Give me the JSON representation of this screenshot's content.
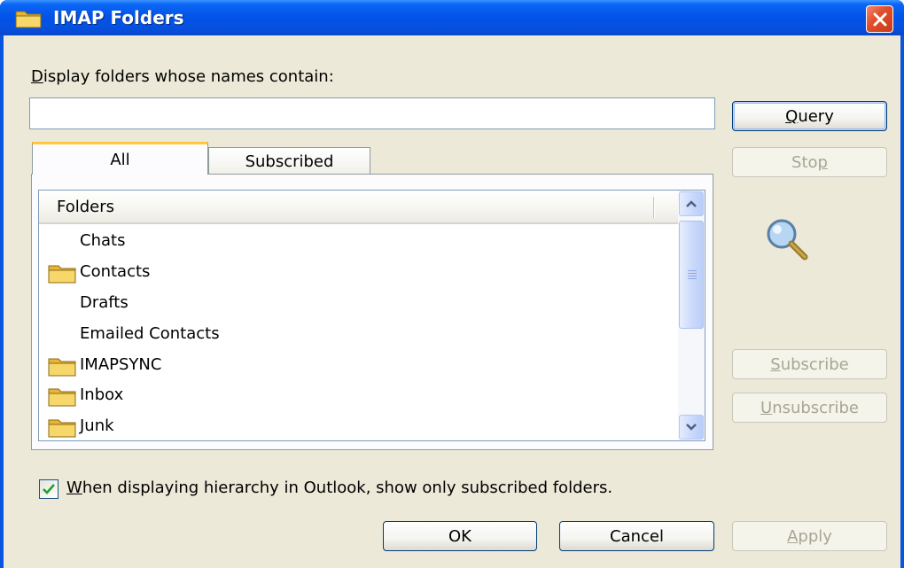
{
  "window": {
    "title": "IMAP Folders",
    "title_icon": "folder-icon",
    "close_icon": "close-icon"
  },
  "filter": {
    "label_pre": "",
    "label_ul": "D",
    "label_post": "isplay folders whose names contain:",
    "value": "",
    "placeholder": ""
  },
  "buttons": {
    "query": {
      "pre": "",
      "ul": "Q",
      "post": "uery"
    },
    "stop": {
      "pre": "Sto",
      "ul": "p",
      "post": ""
    },
    "subscribe": {
      "pre": "",
      "ul": "S",
      "post": "ubscribe"
    },
    "unsubscribe": {
      "pre": "",
      "ul": "U",
      "post": "nsubscribe"
    },
    "ok": "OK",
    "cancel": "Cancel",
    "apply": {
      "pre": "",
      "ul": "A",
      "post": "pply"
    }
  },
  "tabs": [
    {
      "label": "All",
      "active": true
    },
    {
      "label": "Subscribed",
      "active": false
    }
  ],
  "list": {
    "column_header": "Folders",
    "items": [
      {
        "name": "Chats",
        "icon": ""
      },
      {
        "name": "Contacts",
        "icon": "folder-icon"
      },
      {
        "name": "Drafts",
        "icon": ""
      },
      {
        "name": "Emailed Contacts",
        "icon": ""
      },
      {
        "name": "IMAPSYNC",
        "icon": "folder-icon"
      },
      {
        "name": "Inbox",
        "icon": "folder-icon"
      },
      {
        "name": "Junk",
        "icon": "folder-icon"
      }
    ]
  },
  "search_graphic": "magnifier-icon",
  "checkbox": {
    "checked": true,
    "label_pre": "",
    "label_ul": "W",
    "label_post": "hen displaying hierarchy in Outlook, show only subscribed folders."
  },
  "colors": {
    "titlebar": "#0454e8",
    "dialog_bg": "#ece9d8",
    "close_button": "#e2502c",
    "tab_highlight": "#ffc83c"
  }
}
